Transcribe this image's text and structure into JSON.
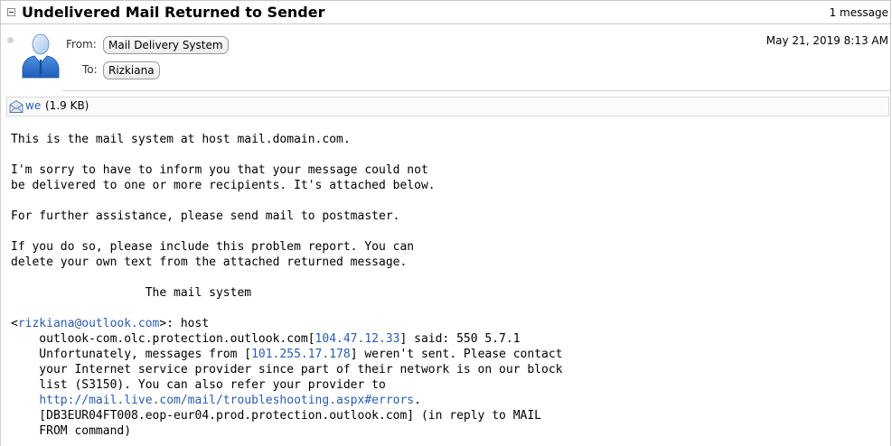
{
  "thread": {
    "subject": "Undelivered Mail Returned to Sender",
    "count": "1 message"
  },
  "message": {
    "from_label": "From:",
    "from": "Mail Delivery System",
    "to_label": "To:",
    "to": "Rizkiana",
    "date": "May 21, 2019 8:13 AM"
  },
  "attachment": {
    "name": "we",
    "size": "(1.9 KB)",
    "icon": "envelope-attachment-icon"
  },
  "body": {
    "l1": "This is the mail system at host mail.domain.com.",
    "l2": "I'm sorry to have to inform you that your message could not",
    "l3": "be delivered to one or more recipients. It's attached below.",
    "l4": "For further assistance, please send mail to postmaster.",
    "l5": "If you do so, please include this problem report. You can",
    "l6": "delete your own text from the attached returned message.",
    "l7": "                   The mail system",
    "l8_pre": "<",
    "l8_email": "rizkiana@outlook.com",
    "l8_post": ">: host",
    "l9_pre": "    outlook-com.olc.protection.outlook.com[",
    "l9_ip": "104.47.12.33",
    "l9_post": "] said: 550 5.7.1",
    "l10_pre": "    Unfortunately, messages from [",
    "l10_ip": "101.255.17.178",
    "l10_post": "] weren't sent. Please contact",
    "l11": "    your Internet service provider since part of their network is on our block",
    "l12": "    list (S3150). You can also refer your provider to",
    "l13_pre": "    ",
    "l13_url": "http://mail.live.com/mail/troubleshooting.aspx#errors",
    "l13_post": ".",
    "l14": "    [DB3EUR04FT008.eop-eur04.prod.protection.outlook.com] (in reply to MAIL",
    "l15": "    FROM command)"
  },
  "colors": {
    "link": "#2a5db0",
    "border": "#c8c8c8"
  }
}
